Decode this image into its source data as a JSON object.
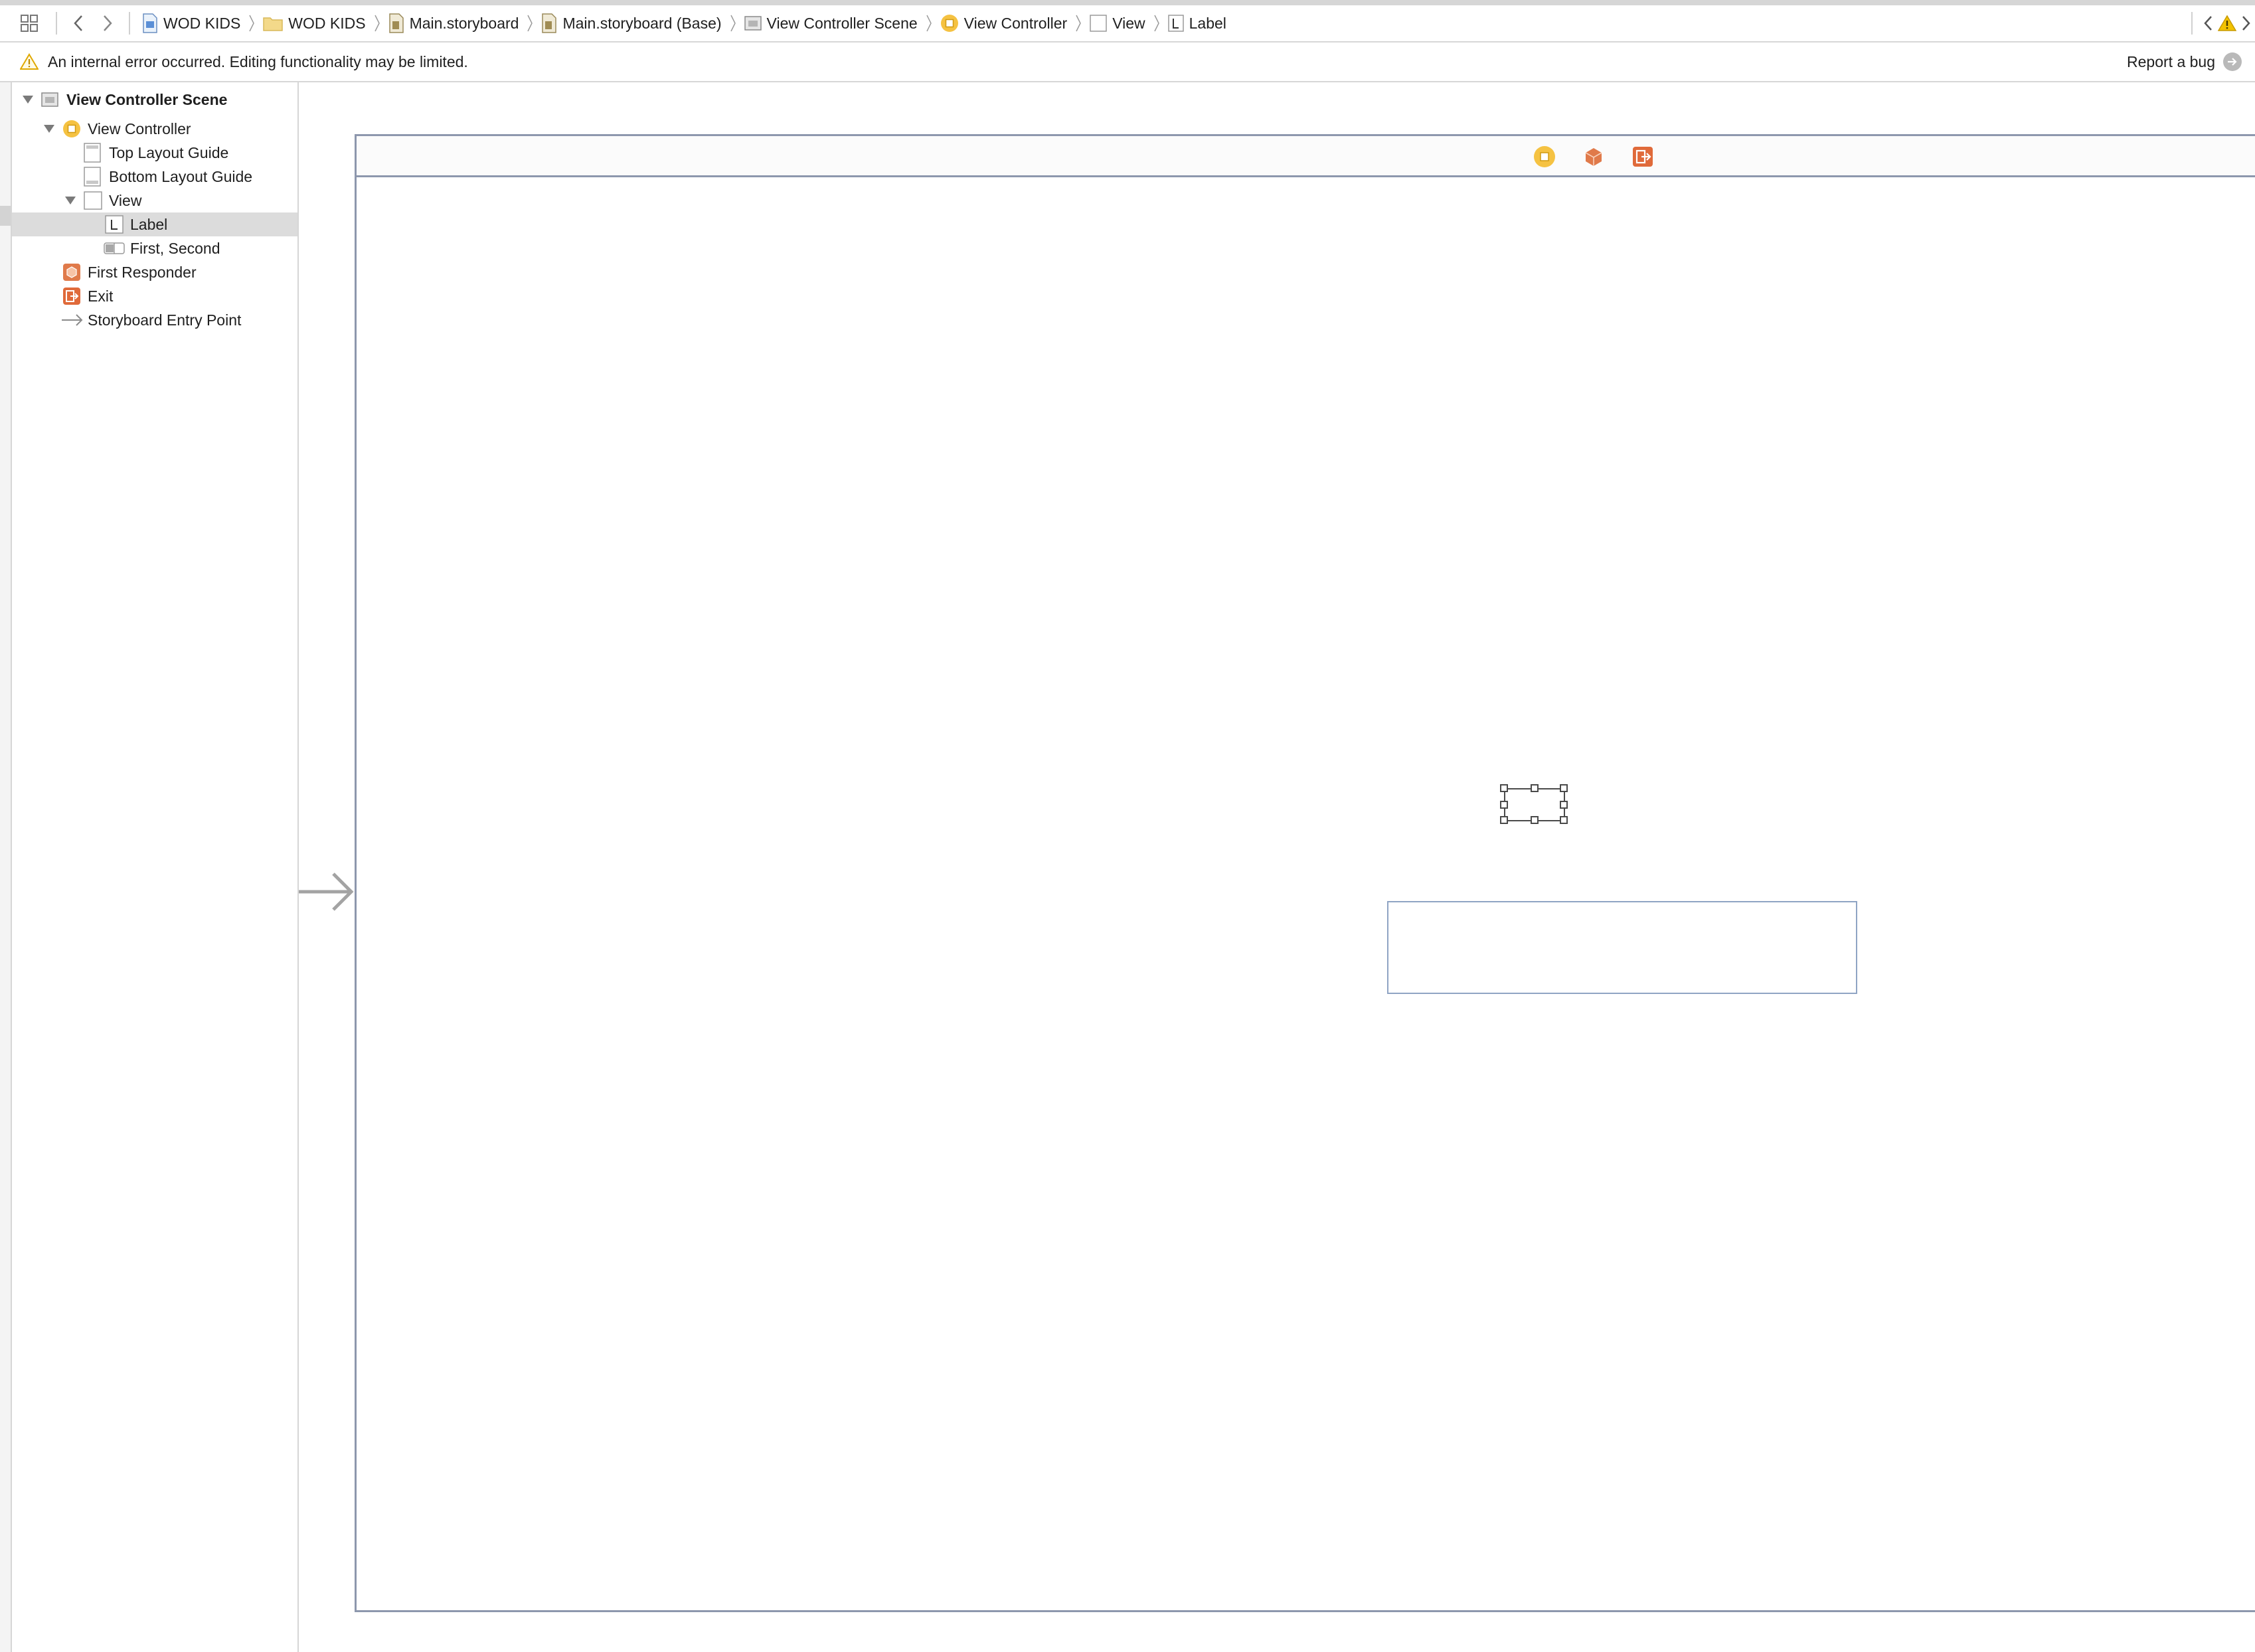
{
  "jumpbar": {
    "crumbs": [
      {
        "label": "WOD KIDS",
        "icon": "project-file-icon"
      },
      {
        "label": "WOD KIDS",
        "icon": "folder-icon"
      },
      {
        "label": "Main.storyboard",
        "icon": "storyboard-file-icon"
      },
      {
        "label": "Main.storyboard (Base)",
        "icon": "storyboard-file-icon"
      },
      {
        "label": "View Controller Scene",
        "icon": "scene-icon"
      },
      {
        "label": "View Controller",
        "icon": "view-controller-icon"
      },
      {
        "label": "View",
        "icon": "view-icon"
      },
      {
        "label": "Label",
        "icon": "label-icon"
      }
    ]
  },
  "errorbar": {
    "message": "An internal error occurred. Editing functionality may be limited.",
    "report_label": "Report a bug"
  },
  "outline": {
    "items": [
      {
        "label": "View Controller Scene",
        "icon": "scene-icon"
      },
      {
        "label": "View Controller",
        "icon": "view-controller-icon"
      },
      {
        "label": "Top Layout Guide",
        "icon": "layout-guide-icon"
      },
      {
        "label": "Bottom Layout Guide",
        "icon": "layout-guide-icon"
      },
      {
        "label": "View",
        "icon": "view-icon"
      },
      {
        "label": "Label",
        "icon": "label-icon"
      },
      {
        "label": "First, Second",
        "icon": "segmented-control-icon"
      },
      {
        "label": "First Responder",
        "icon": "first-responder-icon"
      },
      {
        "label": "Exit",
        "icon": "exit-icon"
      },
      {
        "label": "Storyboard Entry Point",
        "icon": "entry-point-arrow-icon"
      }
    ]
  },
  "colors": {
    "view_controller": "#f5c242",
    "first_responder": "#e07a4a",
    "exit": "#e06a3a",
    "warning": "#f2c200",
    "scene_border": "#8d97ad",
    "selection": "#dcdcdc"
  }
}
